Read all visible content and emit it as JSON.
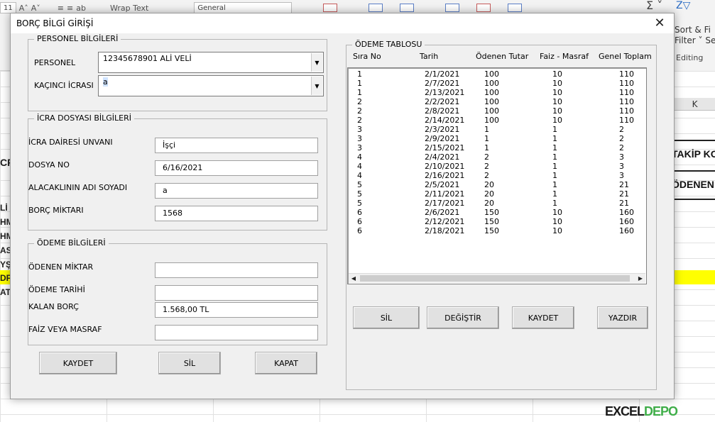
{
  "excel": {
    "font_size": "11",
    "wrap_text": "Wrap Text",
    "number_format": "General",
    "sort_line1": "Sort &",
    "sort_line2": "Filter",
    "find_line1": "Fi",
    "find_line2": "Sel",
    "editing_label": "Editing",
    "column_k": "K",
    "cell_takip": "TAKİP KO",
    "cell_odenen": "ÖDENEN",
    "left_cells": [
      "CR",
      "Lİ",
      "HM",
      "HM",
      "AS",
      "YŞ",
      "DF",
      "AT"
    ],
    "logo_a": "EXCEL",
    "logo_b": "DEPO"
  },
  "dialog": {
    "title": "BORÇ BİLGİ GİRİŞİ",
    "close_symbol": "✕",
    "personel_group": {
      "legend": "PERSONEL BİLGİLERİ",
      "personel_label": "PERSONEL",
      "personel_value": "12345678901 ALİ VELİ",
      "kacinci_label": "KAÇINCI İCRASI",
      "kacinci_value": "a"
    },
    "icra_group": {
      "legend": "İCRA DOSYASI BİLGİLERİ",
      "daire_label": "İCRA DAİRESİ UNVANI",
      "daire_value": "İşçi",
      "dosya_label": "DOSYA NO",
      "dosya_value": "6/16/2021",
      "alacakli_label": "ALACAKLININ ADI SOYADI",
      "alacakli_value": "a",
      "borc_label": "BORÇ MİKTARI",
      "borc_value": "1568"
    },
    "odeme_group": {
      "legend": "ÖDEME BİLGİLERİ",
      "miktar_label": "ÖDENEN MİKTAR",
      "miktar_value": "",
      "tarih_label": "ÖDEME TARİHİ",
      "tarih_value": "",
      "kalan_label": "KALAN BORÇ",
      "kalan_value": "1.568,00 TL",
      "faiz_label": "FAİZ VEYA MASRAF",
      "faiz_value": ""
    },
    "left_buttons": {
      "kaydet": "KAYDET",
      "sil": "SİL",
      "kapat": "KAPAT"
    },
    "table_group": {
      "legend": "ÖDEME TABLOSU",
      "headers": [
        "Sıra No",
        "Tarih",
        "Ödenen Tutar",
        "Faiz - Masraf",
        "Genel Toplam"
      ],
      "rows": [
        [
          "1",
          "2/1/2021",
          "100",
          "10",
          "110"
        ],
        [
          "1",
          "2/7/2021",
          "100",
          "10",
          "110"
        ],
        [
          "1",
          "2/13/2021",
          "100",
          "10",
          "110"
        ],
        [
          "2",
          "2/2/2021",
          "100",
          "10",
          "110"
        ],
        [
          "2",
          "2/8/2021",
          "100",
          "10",
          "110"
        ],
        [
          "2",
          "2/14/2021",
          "100",
          "10",
          "110"
        ],
        [
          "3",
          "2/3/2021",
          "1",
          "1",
          "2"
        ],
        [
          "3",
          "2/9/2021",
          "1",
          "1",
          "2"
        ],
        [
          "3",
          "2/15/2021",
          "1",
          "1",
          "2"
        ],
        [
          "4",
          "2/4/2021",
          "2",
          "1",
          "3"
        ],
        [
          "4",
          "2/10/2021",
          "2",
          "1",
          "3"
        ],
        [
          "4",
          "2/16/2021",
          "2",
          "1",
          "3"
        ],
        [
          "5",
          "2/5/2021",
          "20",
          "1",
          "21"
        ],
        [
          "5",
          "2/11/2021",
          "20",
          "1",
          "21"
        ],
        [
          "5",
          "2/17/2021",
          "20",
          "1",
          "21"
        ],
        [
          "6",
          "2/6/2021",
          "150",
          "10",
          "160"
        ],
        [
          "6",
          "2/12/2021",
          "150",
          "10",
          "160"
        ],
        [
          "6",
          "2/18/2021",
          "150",
          "10",
          "160"
        ]
      ]
    },
    "right_buttons": {
      "sil": "SİL",
      "degistir": "DEĞİŞTİR",
      "kaydet": "KAYDET",
      "yazdir": "YAZDIR"
    }
  }
}
